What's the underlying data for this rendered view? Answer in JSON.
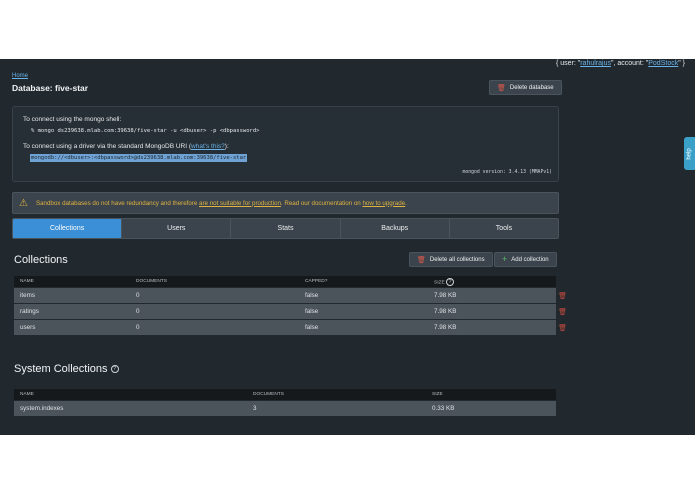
{
  "user_bar": {
    "prefix": "{ user: \"",
    "user": "rahulrajus",
    "middle": "\", account: \"",
    "account": "PodStock",
    "suffix": "\" }"
  },
  "breadcrumb": {
    "home": "Home"
  },
  "page_title": "Database: five-star",
  "delete_database_label": "Delete database",
  "connect": {
    "shell_heading": "To connect using the mongo shell:",
    "shell_command": "% mongo ds239638.mlab.com:39638/five-star -u <dbuser> -p <dbpassword>",
    "driver_heading_pre": "To connect using a driver via the standard MongoDB URI (",
    "driver_heading_link": "what's this?",
    "driver_heading_post": "):",
    "uri": "mongodb://<dbuser>:<dbpassword>@ds239638.mlab.com:39638/five-star",
    "version": "mongod version: 3.4.13 (MMAPv1)"
  },
  "warning": {
    "text_pre": "Sandbox databases do not have redundancy and therefore ",
    "link1": "are not suitable for production",
    "text_mid": ". Read our documentation on ",
    "link2": "how to upgrade",
    "text_post": "."
  },
  "tabs": [
    {
      "label": "Collections",
      "active": true
    },
    {
      "label": "Users"
    },
    {
      "label": "Stats"
    },
    {
      "label": "Backups"
    },
    {
      "label": "Tools"
    }
  ],
  "collections": {
    "title": "Collections",
    "delete_all_label": "Delete all collections",
    "add_label": "Add collection",
    "headers": [
      "NAME",
      "DOCUMENTS",
      "CAPPED?",
      "SIZE"
    ],
    "rows": [
      {
        "name": "items",
        "documents": "0",
        "capped": "false",
        "size": "7.98 KB"
      },
      {
        "name": "ratings",
        "documents": "0",
        "capped": "false",
        "size": "7.98 KB"
      },
      {
        "name": "users",
        "documents": "0",
        "capped": "false",
        "size": "7.98 KB"
      }
    ]
  },
  "system_collections": {
    "title": "System Collections",
    "headers": [
      "NAME",
      "DOCUMENTS",
      "SIZE"
    ],
    "rows": [
      {
        "name": "system.indexes",
        "documents": "3",
        "size": "0.33 KB"
      }
    ]
  },
  "help_tab": "help",
  "icons": {
    "trash": "trash-icon",
    "plus": "plus-icon",
    "warning": "warning-triangle-icon",
    "help": "question-circle-icon"
  },
  "colors": {
    "background": "#21292f",
    "active_tab": "#3a8fd6",
    "link": "#6ab2e8",
    "warning": "#e0b341",
    "danger": "#e35a4b",
    "help_tab": "#3aa0c8"
  }
}
